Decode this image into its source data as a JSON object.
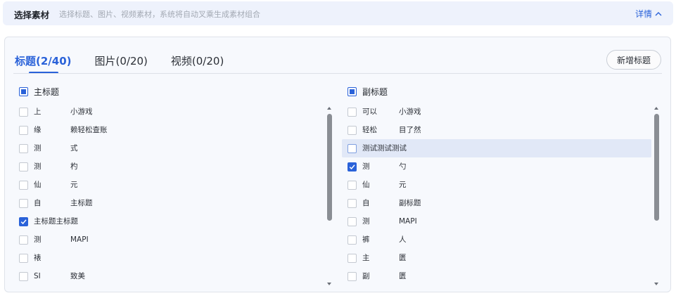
{
  "header": {
    "title": "选择素材",
    "description": "选择标题、图片、视频素材，系统将自动叉乘生成素材组合",
    "detail_label": "详情"
  },
  "tabs": [
    {
      "label": "标题(2/40)",
      "active": true
    },
    {
      "label": "图片(0/20)",
      "active": false
    },
    {
      "label": "视频(0/20)",
      "active": false
    }
  ],
  "add_button_label": "新增标题",
  "main_titles": {
    "header_label": "主标题",
    "select_all_state": "partial",
    "items": [
      {
        "a": "上",
        "b": "小游戏",
        "checked": false
      },
      {
        "a": "缘",
        "b": "赖轻松查账",
        "checked": false
      },
      {
        "a": "测",
        "b": "式",
        "checked": false
      },
      {
        "a": "测",
        "b": "杓",
        "checked": false
      },
      {
        "a": "仙",
        "b": "元",
        "checked": false
      },
      {
        "a": "自",
        "b": "主标题",
        "checked": false
      },
      {
        "a": "主标题主标题",
        "b": "",
        "checked": true
      },
      {
        "a": "测",
        "b": "MAPI",
        "checked": false
      },
      {
        "a": "裱",
        "b": "",
        "checked": false
      },
      {
        "a": "SI",
        "b": "致美",
        "checked": false
      }
    ]
  },
  "sub_titles": {
    "header_label": "副标题",
    "select_all_state": "partial",
    "items": [
      {
        "a": "可以",
        "b": "小游戏",
        "checked": false
      },
      {
        "a": "轻松",
        "b": "目了然",
        "checked": false
      },
      {
        "a": "测试测试测试",
        "b": "",
        "checked": false,
        "highlighted": true
      },
      {
        "a": "测",
        "b": "勺",
        "checked": true
      },
      {
        "a": "仙",
        "b": "元",
        "checked": false
      },
      {
        "a": "自",
        "b": "副标题",
        "checked": false
      },
      {
        "a": "测",
        "b": "MAPI",
        "checked": false
      },
      {
        "a": "裤",
        "b": "人",
        "checked": false
      },
      {
        "a": "主",
        "b": "匮",
        "checked": false
      },
      {
        "a": "副",
        "b": "匮",
        "checked": false
      }
    ]
  },
  "colors": {
    "accent": "#2a62d9",
    "header_bg": "#eef2fc",
    "panel_bg": "#f7f9fd",
    "highlight_row": "#e1e8f7"
  }
}
